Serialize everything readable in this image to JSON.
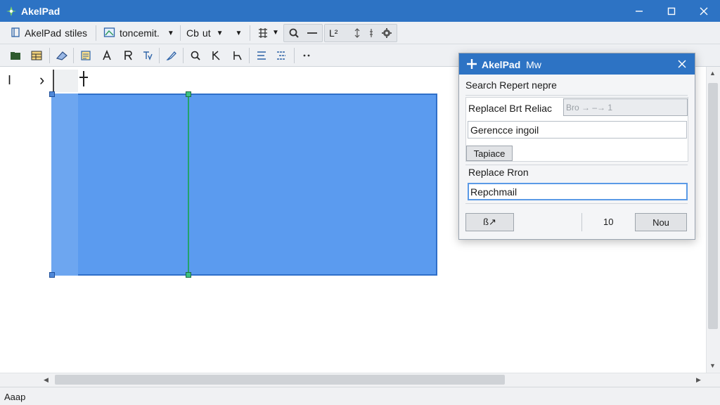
{
  "window": {
    "title": "AkelPad"
  },
  "toolbar1": {
    "file_label": "AkelPad",
    "file_extra": "stiles",
    "doc_label": "toncemit.",
    "font_label": "Cb",
    "font_extra": "ut",
    "group_label": "L²"
  },
  "ruler": {
    "left_mark": "I",
    "chevron": "›",
    "cursor_mark": "ı"
  },
  "dialog": {
    "title": "AkelPad",
    "title_extra": "Mw",
    "search_label": "Search Repert nepre",
    "replace_label": "Replacel Brt Reliac",
    "replace_disabled_value": "Bro → –→ 1",
    "generic_input_value": "Gerencce ingoil",
    "small_button": "Tapiace",
    "replace_from_label": "Replace Rron",
    "replace_from_value": "Repchmail",
    "left_button": "ß↗",
    "count_value": "10",
    "right_button": "Nou"
  },
  "statusbar": {
    "text": "Aaap"
  },
  "colors": {
    "titlebar": "#2d73c4",
    "selection": "#5b9bef",
    "divider": "#23a36b"
  }
}
